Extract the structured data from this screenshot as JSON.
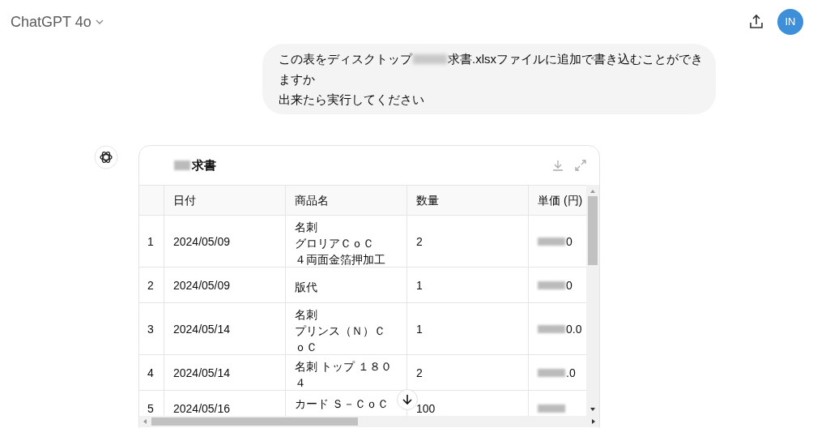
{
  "header": {
    "model": "ChatGPT 4o",
    "avatar": "IN"
  },
  "user_message": {
    "part_1": "この表をディスクトップ",
    "part_2": "求書.xlsxファイルに追加で書き込むことができ",
    "line_2": "ますか",
    "line_3": "出来たら実行してください"
  },
  "table_card": {
    "title": "求書",
    "columns": [
      "日付",
      "商品名",
      "数量",
      "単価 (円)"
    ],
    "rows": [
      {
        "index": "1",
        "date": "2024/05/09",
        "product": [
          "名刺",
          "グロリアＣｏＣ",
          "４両面金箔押加工"
        ],
        "qty": "2",
        "price": "0"
      },
      {
        "index": "2",
        "date": "2024/05/09",
        "product": [
          "版代"
        ],
        "qty": "1",
        "price": "0"
      },
      {
        "index": "3",
        "date": "2024/05/14",
        "product": [
          "名刺",
          "プリンス（Ｎ）Ｃ",
          "ｏＣ"
        ],
        "qty": "1",
        "price": "0.0"
      },
      {
        "index": "4",
        "date": "2024/05/14",
        "product": [
          "名刺 トップ １８０",
          "４"
        ],
        "qty": "2",
        "price": ".0"
      },
      {
        "index": "5",
        "date": "2024/05/16",
        "product": [
          "カード Ｓ－ＣｏＣ"
        ],
        "qty": "100",
        "price": ""
      }
    ]
  }
}
